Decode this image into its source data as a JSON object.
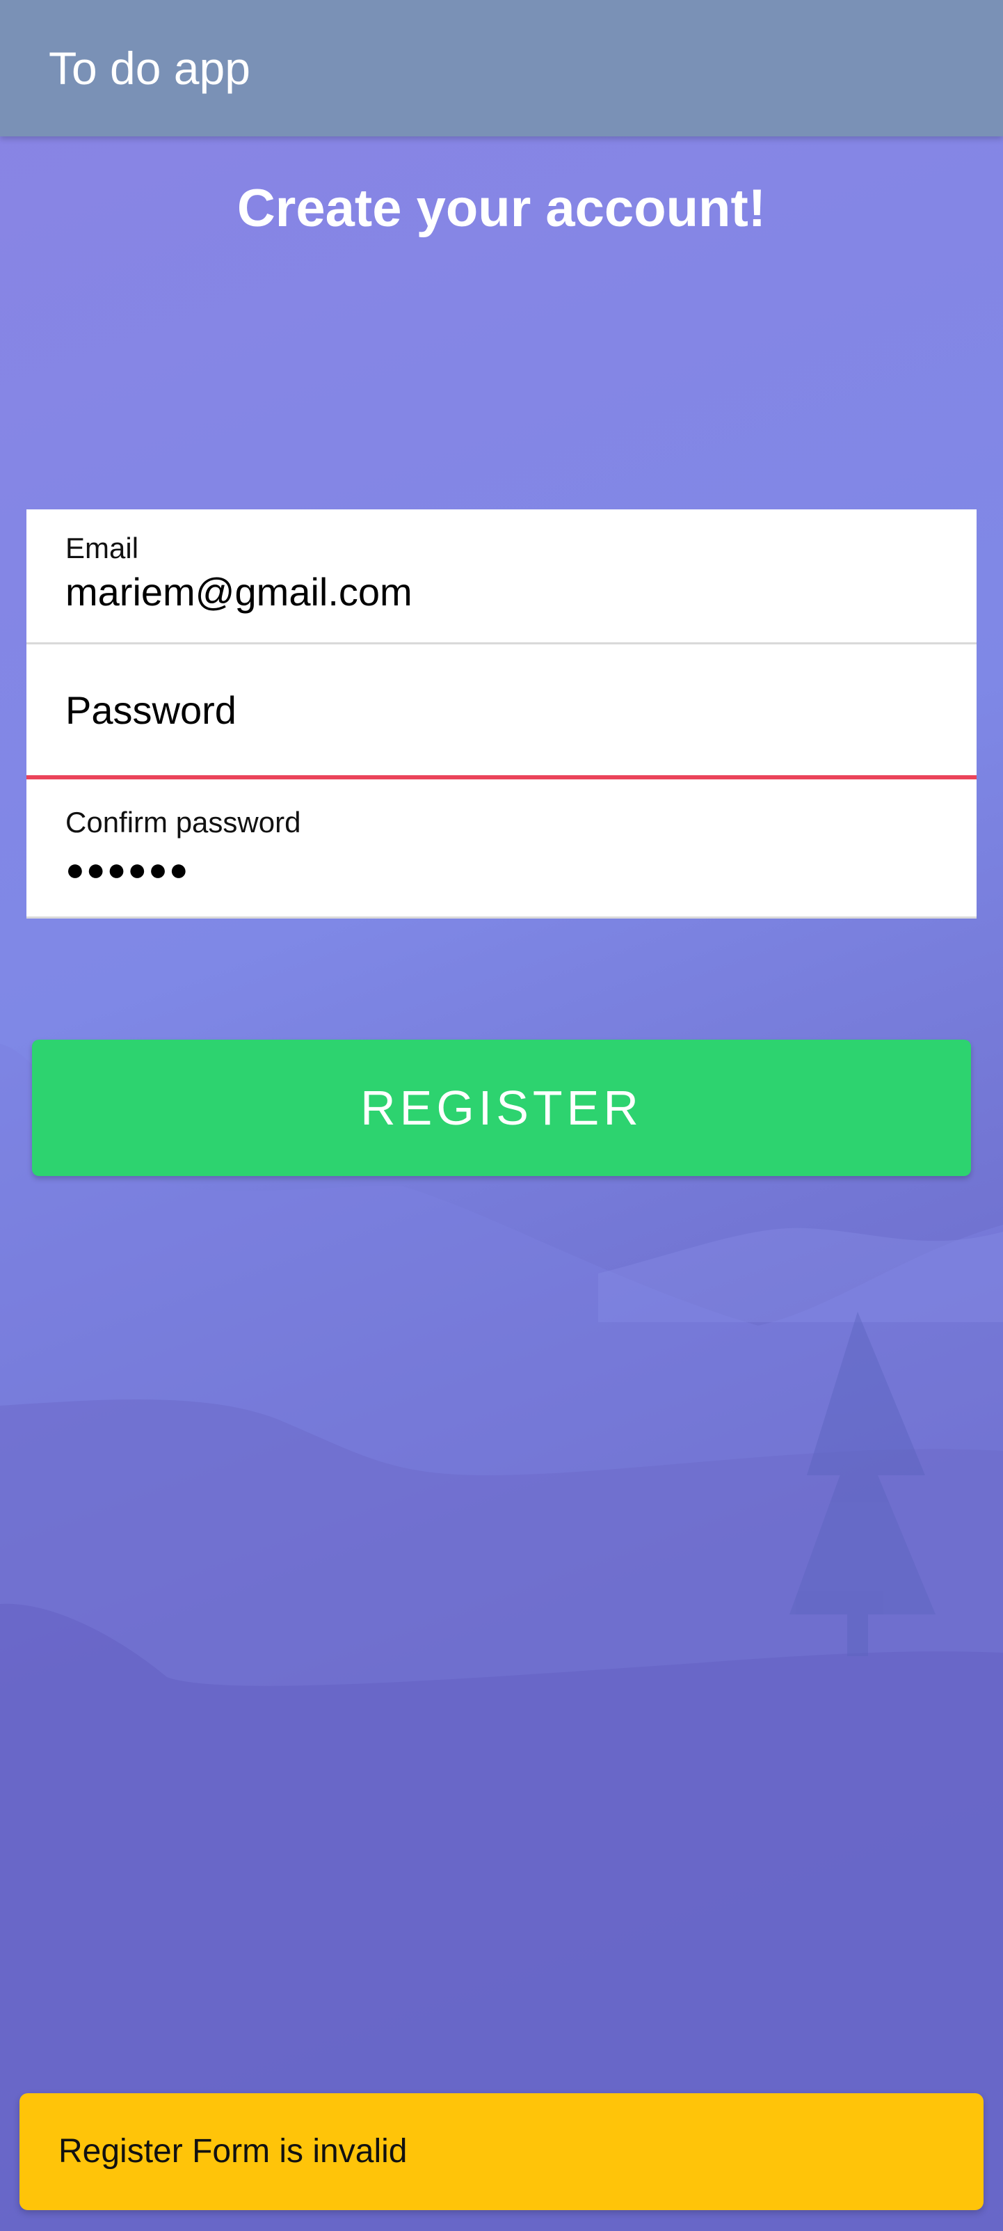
{
  "app": {
    "title": "To do app"
  },
  "page": {
    "heading": "Create your account!"
  },
  "form": {
    "email": {
      "label": "Email",
      "value": "mariem@gmail.com"
    },
    "password": {
      "placeholder": "Password",
      "value": "",
      "state": "invalid"
    },
    "confirm_password": {
      "label": "Confirm password",
      "masked_value": "●●●●●●"
    },
    "submit_label": "REGISTER"
  },
  "toast": {
    "message": "Register Form is invalid"
  },
  "colors": {
    "toolbar": "#7a91b6",
    "button": "#2dd36f",
    "invalid_underline": "#eb445a",
    "toast": "#ffc409"
  }
}
